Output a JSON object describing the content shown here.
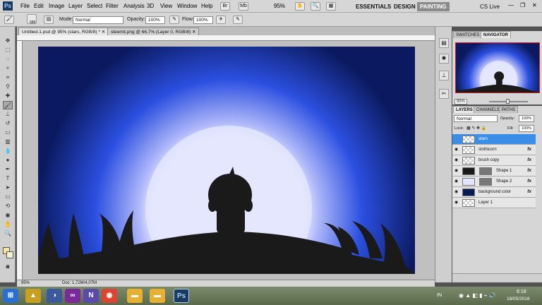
{
  "app": {
    "logo": "Ps"
  },
  "menu": [
    "File",
    "Edit",
    "Image",
    "Layer",
    "Select",
    "Filter",
    "Analysis",
    "3D",
    "View",
    "Window",
    "Help"
  ],
  "zoom_menu": "95%",
  "workspaces": {
    "essentials": "ESSENTIALS",
    "design": "DESIGN",
    "painting": "PAINTING",
    "cslive": "CS Live"
  },
  "options": {
    "brush_size": "688",
    "mode_label": "Mode:",
    "mode_value": "Normal",
    "opacity_label": "Opacity:",
    "opacity_value": "100%",
    "flow_label": "Flow:",
    "flow_value": "100%"
  },
  "tabs": [
    {
      "label": "Untitled-1.psd @ 95% (stars, RGB/8) *"
    },
    {
      "label": "steemit.png @ 66,7% (Layer 0, RGB/8)"
    }
  ],
  "status": {
    "zoom": "95%",
    "doc": "Doc: 1,72M/4,07M"
  },
  "nav_tabs": [
    "SWATCHES",
    "NAVIGATOR"
  ],
  "layer_tabs": [
    "LAYERS",
    "CHANNELS",
    "PATHS"
  ],
  "layers_panel": {
    "blend": "Normal",
    "opacity_label": "Opacity:",
    "opacity_value": "100%",
    "lock_label": "Lock:",
    "fill_label": "Fill:",
    "fill_value": "100%"
  },
  "layers": [
    {
      "name": "stars",
      "selected": true,
      "fx": false
    },
    {
      "name": "slothicorn",
      "selected": false,
      "fx": true
    },
    {
      "name": "brush copy",
      "selected": false,
      "fx": true
    },
    {
      "name": "Shape 1",
      "selected": false,
      "fx": true
    },
    {
      "name": "Shape 2",
      "selected": false,
      "fx": true
    },
    {
      "name": "background color",
      "selected": false,
      "fx": true
    },
    {
      "name": "Layer 1",
      "selected": false,
      "fx": false
    }
  ],
  "fx_label": "fx",
  "taskbar": {
    "lang": "IN",
    "time": "6:18",
    "date": "18/05/2018"
  },
  "colors": {
    "sky_top": "#0a1a55",
    "sky_mid": "#1a3fd8",
    "moon": "#e8eaff",
    "silhouette": "#1a1a1a",
    "selection": "#3b8ee8"
  }
}
